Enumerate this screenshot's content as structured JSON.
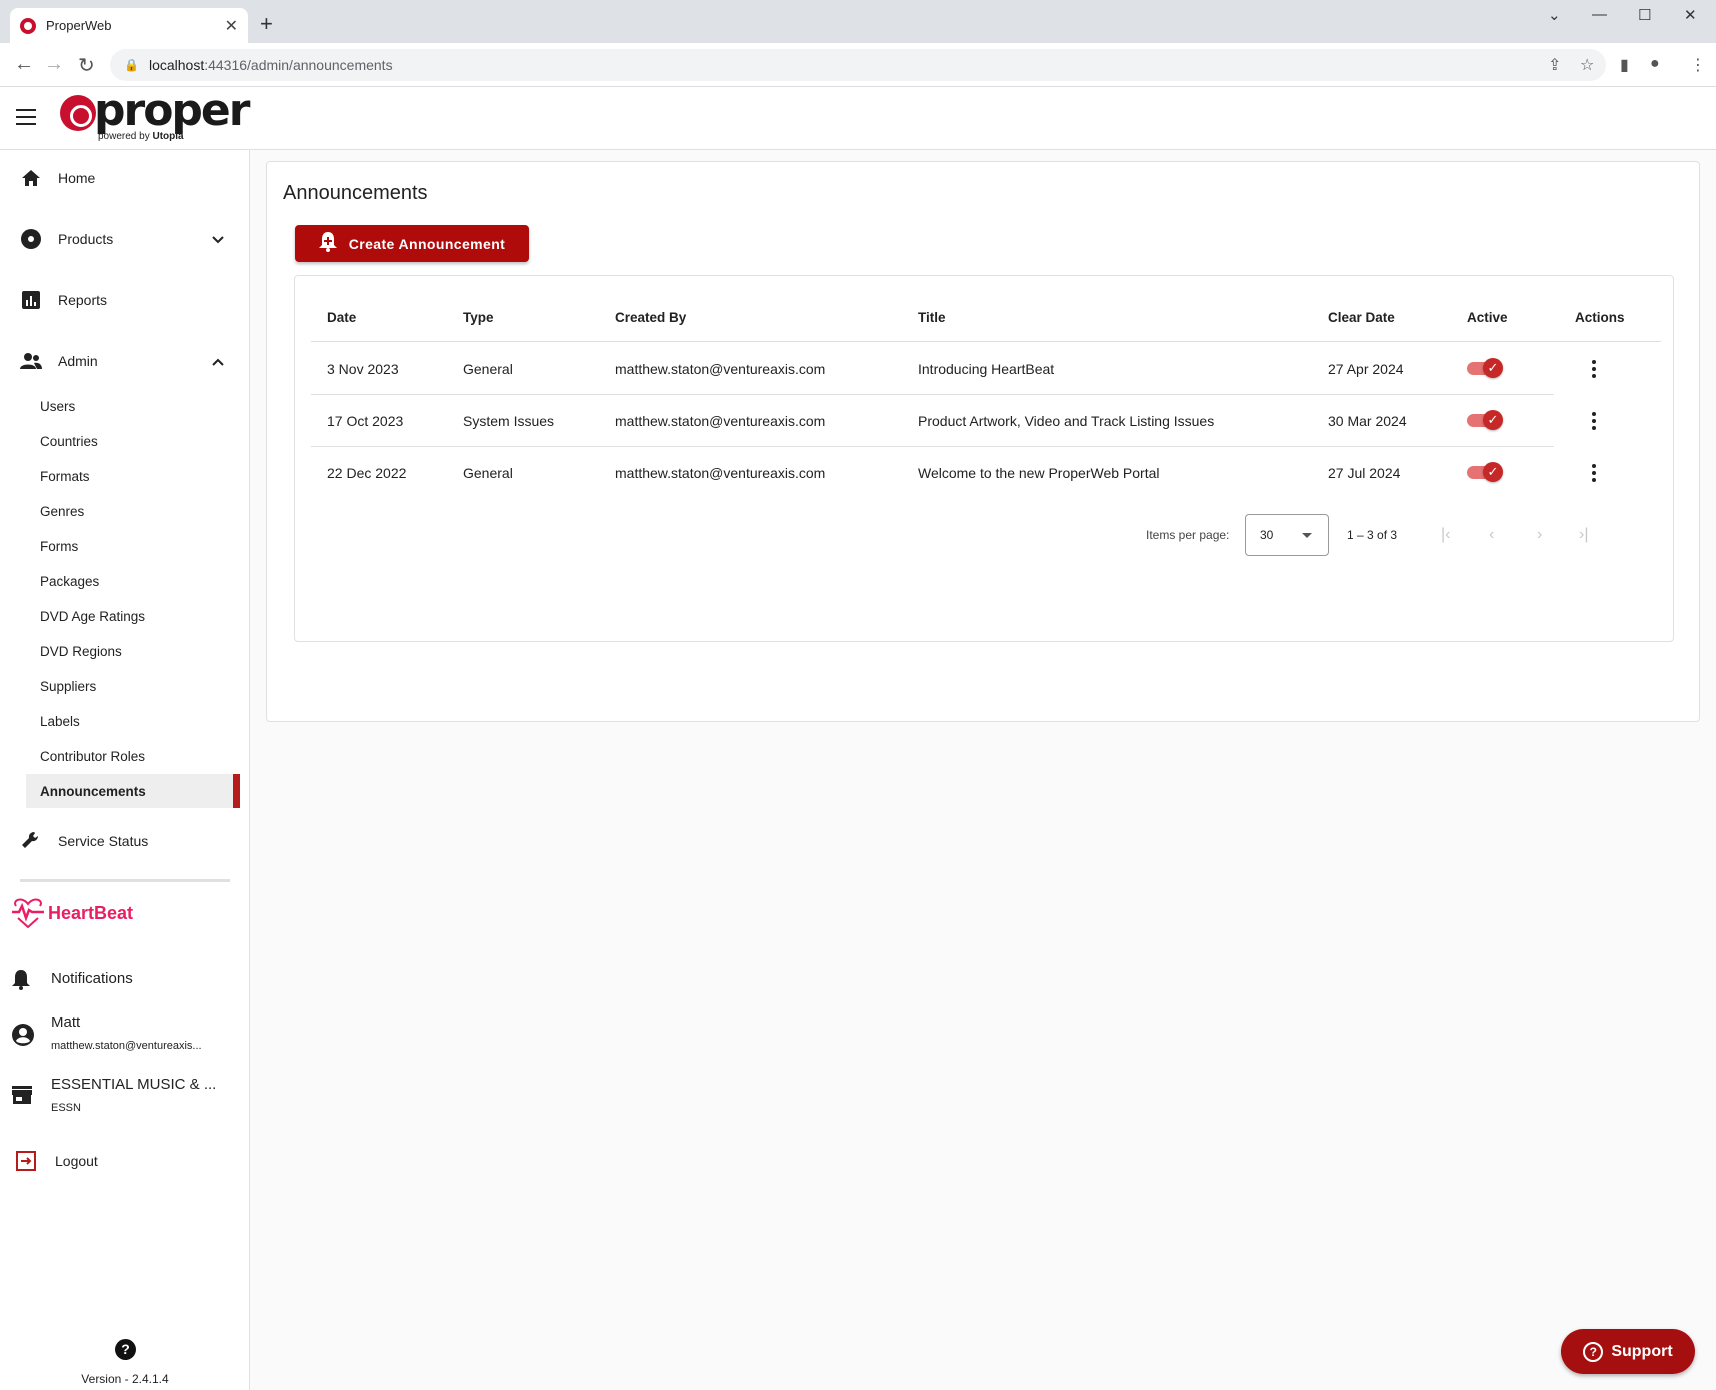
{
  "browser": {
    "tab_title": "ProperWeb",
    "url_host": "localhost",
    "url_path": ":44316/admin/announcements"
  },
  "brand": {
    "logo_word": "proper",
    "tagline_prefix": "powered by",
    "tagline_brand": "Utopia"
  },
  "sidebar": {
    "items": [
      {
        "label": "Home",
        "icon": "home-icon"
      },
      {
        "label": "Products",
        "icon": "disc-icon"
      },
      {
        "label": "Reports",
        "icon": "bar-chart-icon"
      },
      {
        "label": "Admin",
        "icon": "people-icon"
      }
    ],
    "admin_sub": [
      "Users",
      "Countries",
      "Formats",
      "Genres",
      "Forms",
      "Packages",
      "DVD Age Ratings",
      "DVD Regions",
      "Suppliers",
      "Labels",
      "Contributor Roles",
      "Announcements"
    ],
    "active_sub": "Announcements",
    "service_status": "Service Status",
    "heartbeat": "HeartBeat",
    "notifications": "Notifications",
    "user_name": "Matt",
    "user_email": "matthew.staton@ventureaxis...",
    "company_name": "ESSENTIAL MUSIC & ...",
    "company_code": "ESSN",
    "logout": "Logout",
    "version": "Version - 2.4.1.4"
  },
  "main": {
    "title": "Announcements",
    "create_button": "Create Announcement",
    "columns": [
      "Date",
      "Type",
      "Created By",
      "Title",
      "Clear Date",
      "Active",
      "Actions"
    ],
    "rows": [
      {
        "date": "3 Nov 2023",
        "type": "General",
        "created_by": "matthew.staton@ventureaxis.com",
        "title": "Introducing HeartBeat",
        "clear_date": "27 Apr 2024",
        "active": true
      },
      {
        "date": "17 Oct 2023",
        "type": "System Issues",
        "created_by": "matthew.staton@ventureaxis.com",
        "title": "Product Artwork, Video and Track Listing Issues",
        "clear_date": "30 Mar 2024",
        "active": true
      },
      {
        "date": "22 Dec 2022",
        "type": "General",
        "created_by": "matthew.staton@ventureaxis.com",
        "title": "Welcome to the new ProperWeb Portal",
        "clear_date": "27 Jul 2024",
        "active": true
      }
    ],
    "paginator": {
      "items_per_page_label": "Items per page:",
      "items_per_page": "30",
      "range": "1 – 3 of 3"
    }
  },
  "support_button": "Support",
  "colors": {
    "brand_red": "#b00b0b",
    "heartbeat_pink": "#e91e63",
    "toggle_on": "#c62828"
  }
}
